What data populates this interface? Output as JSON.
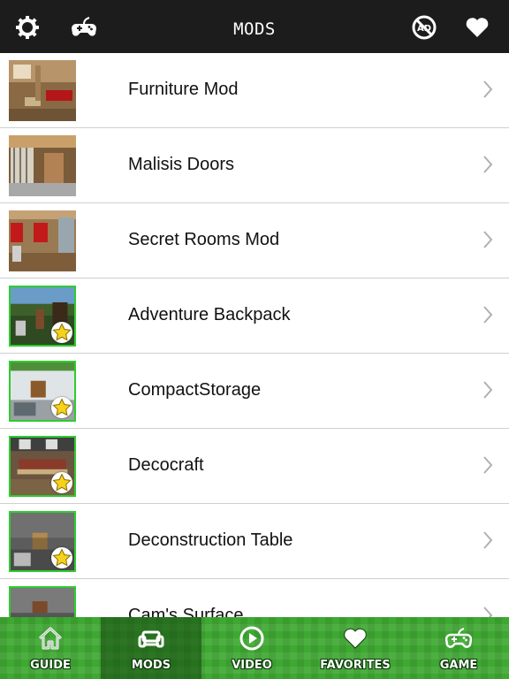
{
  "header": {
    "title": "MODS",
    "left_icons": [
      "gear-icon",
      "gamepad-icon"
    ],
    "right_icons": [
      "no-ads-icon",
      "heart-icon"
    ]
  },
  "mods": [
    {
      "name": "Furniture Mod",
      "featured": false
    },
    {
      "name": "Malisis Doors",
      "featured": false
    },
    {
      "name": "Secret Rooms Mod",
      "featured": false
    },
    {
      "name": "Adventure Backpack",
      "featured": true
    },
    {
      "name": "CompactStorage",
      "featured": true
    },
    {
      "name": "Decocraft",
      "featured": true
    },
    {
      "name": "Deconstruction Table",
      "featured": true
    },
    {
      "name": "Cam's Surface",
      "featured": true
    }
  ],
  "tabs": [
    {
      "label": "GUIDE",
      "icon": "home-icon",
      "active": false
    },
    {
      "label": "MODS",
      "icon": "sofa-icon",
      "active": true
    },
    {
      "label": "VIDEO",
      "icon": "play-icon",
      "active": false
    },
    {
      "label": "FAVORITES",
      "icon": "heart-icon",
      "active": false
    },
    {
      "label": "GAME",
      "icon": "gamepad-icon",
      "active": false
    }
  ],
  "colors": {
    "header_bg": "#1c1c1c",
    "tabbar_green": "#3ea832",
    "featured_border": "#2ecc2e",
    "star_yellow": "#f5d21b"
  }
}
